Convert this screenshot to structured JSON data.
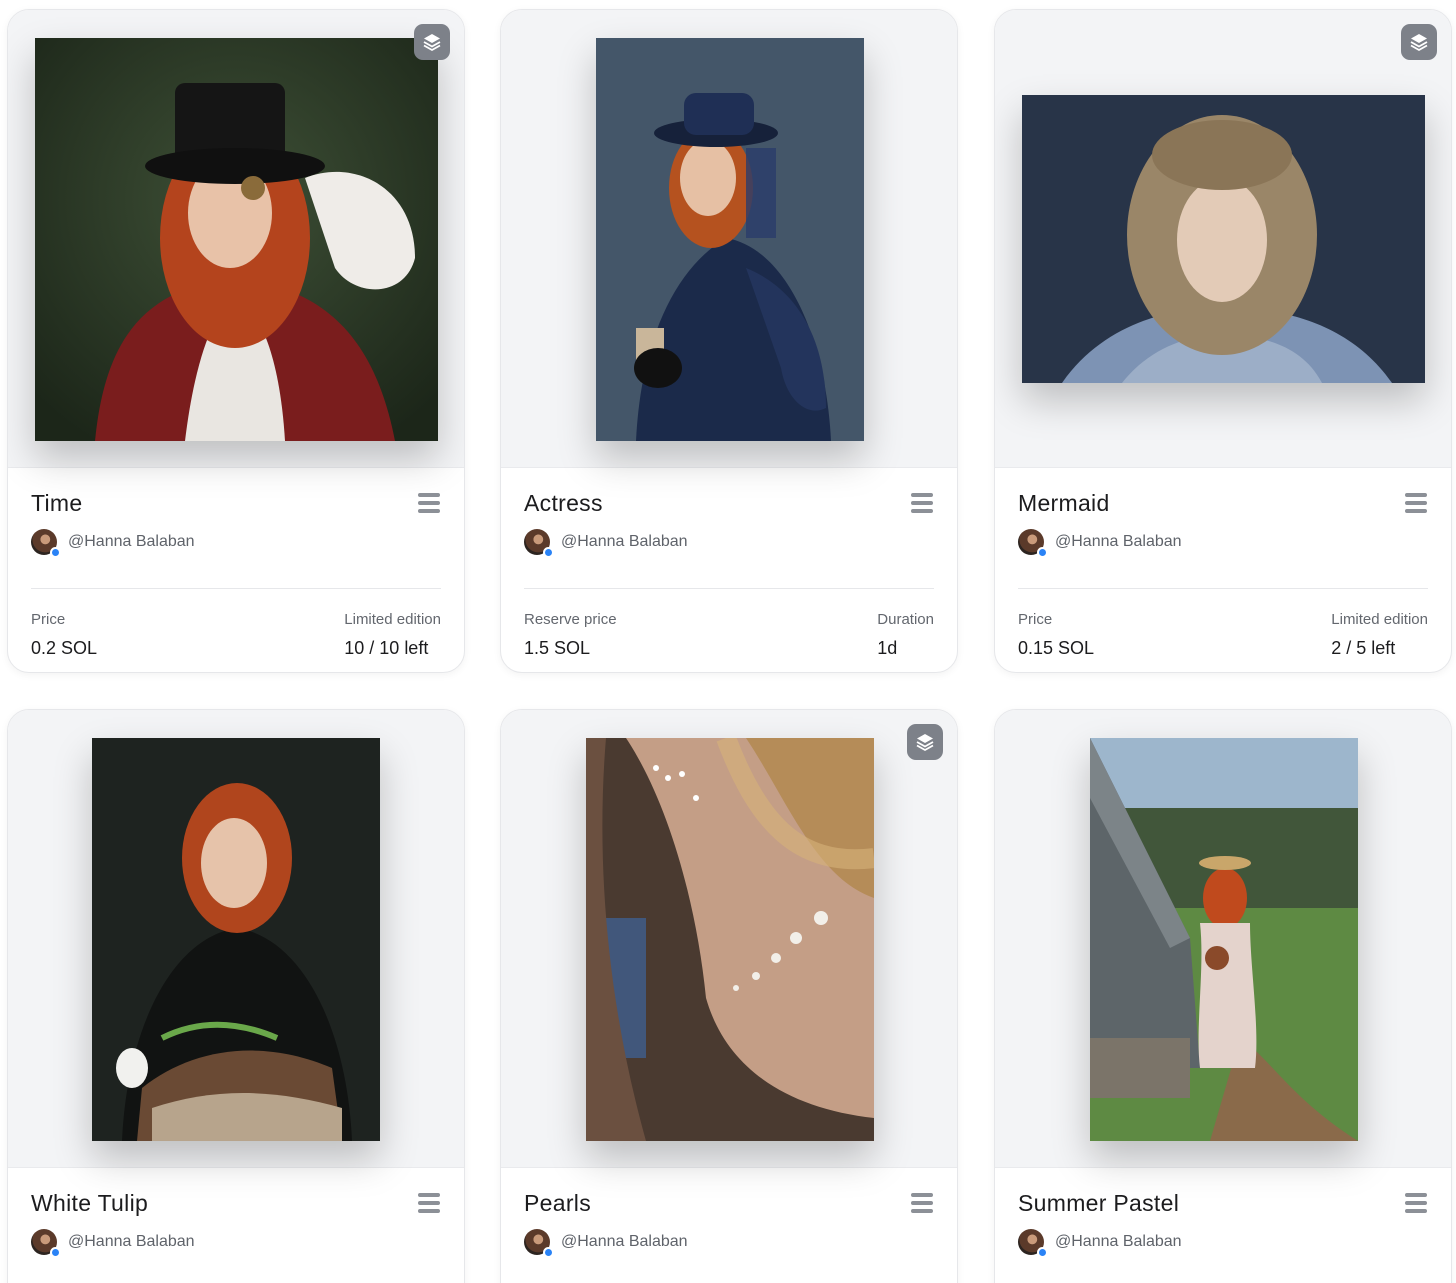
{
  "cards": [
    {
      "title": "Time",
      "creator": "@Hanna Balaban",
      "multi": true,
      "stat1_label": "Price",
      "stat1_value": "0.2 SOL",
      "stat2_label": "Limited edition",
      "stat2_value": "10 / 10 left"
    },
    {
      "title": "Actress",
      "creator": "@Hanna Balaban",
      "multi": false,
      "stat1_label": "Reserve price",
      "stat1_value": "1.5 SOL",
      "stat2_label": "Duration",
      "stat2_value": "1d"
    },
    {
      "title": "Mermaid",
      "creator": "@Hanna Balaban",
      "multi": true,
      "stat1_label": "Price",
      "stat1_value": "0.15 SOL",
      "stat2_label": "Limited edition",
      "stat2_value": "2 / 5 left"
    },
    {
      "title": "White Tulip",
      "creator": "@Hanna Balaban",
      "multi": false
    },
    {
      "title": "Pearls",
      "creator": "@Hanna Balaban",
      "multi": true
    },
    {
      "title": "Summer Pastel",
      "creator": "@Hanna Balaban",
      "multi": false
    }
  ],
  "icons": {
    "edition": "layers-icon",
    "menu": "menu-icon",
    "verified": "verified-badge-icon"
  },
  "colors": {
    "badge": "#7d8189",
    "verified": "#2a83f6",
    "card_border": "#e6e7ea"
  }
}
